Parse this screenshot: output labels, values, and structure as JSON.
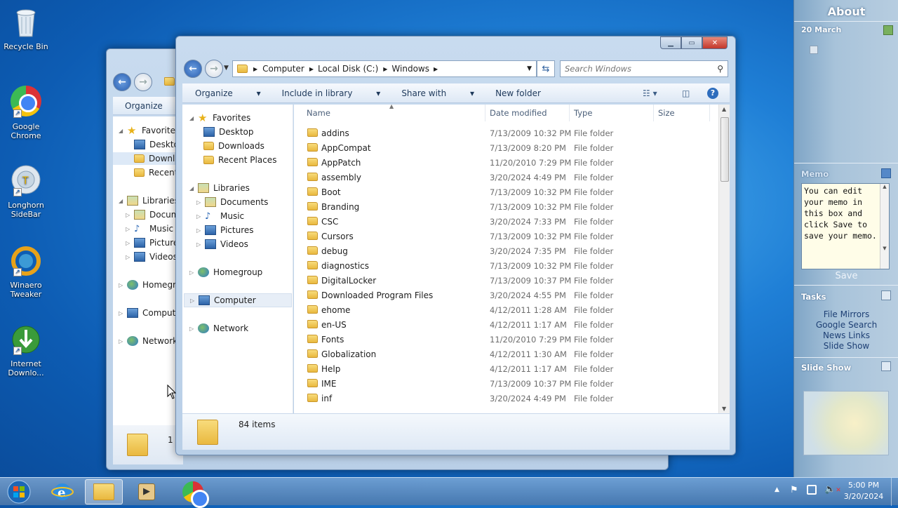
{
  "desktop": {
    "icons": [
      {
        "label": "Recycle Bin",
        "icon": "recycle-bin-icon"
      },
      {
        "label": "Google Chrome",
        "icon": "chrome-icon"
      },
      {
        "label": "Longhorn SideBar",
        "icon": "longhorn-sidebar-icon"
      },
      {
        "label": "Winaero Tweaker",
        "icon": "winaero-tweaker-icon"
      },
      {
        "label": "Internet Downlo...",
        "icon": "internet-download-manager-icon"
      }
    ]
  },
  "back_window": {
    "toolbar": {
      "organize": "Organize"
    },
    "nav": [
      {
        "label": "Favorites",
        "icon": "star-icon"
      },
      {
        "label": "Deskto",
        "icon": "desktop-icon"
      },
      {
        "label": "Downlo",
        "icon": "downloads-icon"
      },
      {
        "label": "Recent",
        "icon": "recent-icon"
      },
      {
        "label": "Libraries",
        "icon": "libraries-icon"
      },
      {
        "label": "Docume",
        "icon": "documents-icon"
      },
      {
        "label": "Music",
        "icon": "music-icon"
      },
      {
        "label": "Picture",
        "icon": "pictures-icon"
      },
      {
        "label": "Videos",
        "icon": "videos-icon"
      },
      {
        "label": "Homegro",
        "icon": "homegroup-icon"
      },
      {
        "label": "Compute",
        "icon": "computer-icon"
      },
      {
        "label": "Network",
        "icon": "network-icon"
      }
    ],
    "status": "1"
  },
  "explorer": {
    "breadcrumb": [
      "Computer",
      "Local Disk (C:)",
      "Windows"
    ],
    "search_placeholder": "Search Windows",
    "toolbar": {
      "organize": "Organize",
      "include": "Include in library",
      "share": "Share with",
      "new_folder": "New folder"
    },
    "nav": {
      "favorites": "Favorites",
      "desktop": "Desktop",
      "downloads": "Downloads",
      "recent": "Recent Places",
      "libraries": "Libraries",
      "documents": "Documents",
      "music": "Music",
      "pictures": "Pictures",
      "videos": "Videos",
      "homegroup": "Homegroup",
      "computer": "Computer",
      "network": "Network"
    },
    "columns": {
      "name": "Name",
      "date": "Date modified",
      "type": "Type",
      "size": "Size"
    },
    "files": [
      {
        "name": "addins",
        "date": "7/13/2009 10:32 PM",
        "type": "File folder"
      },
      {
        "name": "AppCompat",
        "date": "7/13/2009 8:20 PM",
        "type": "File folder"
      },
      {
        "name": "AppPatch",
        "date": "11/20/2010 7:29 PM",
        "type": "File folder"
      },
      {
        "name": "assembly",
        "date": "3/20/2024 4:49 PM",
        "type": "File folder"
      },
      {
        "name": "Boot",
        "date": "7/13/2009 10:32 PM",
        "type": "File folder"
      },
      {
        "name": "Branding",
        "date": "7/13/2009 10:32 PM",
        "type": "File folder"
      },
      {
        "name": "CSC",
        "date": "3/20/2024 7:33 PM",
        "type": "File folder"
      },
      {
        "name": "Cursors",
        "date": "7/13/2009 10:32 PM",
        "type": "File folder"
      },
      {
        "name": "debug",
        "date": "3/20/2024 7:35 PM",
        "type": "File folder"
      },
      {
        "name": "diagnostics",
        "date": "7/13/2009 10:32 PM",
        "type": "File folder"
      },
      {
        "name": "DigitalLocker",
        "date": "7/13/2009 10:37 PM",
        "type": "File folder"
      },
      {
        "name": "Downloaded Program Files",
        "date": "3/20/2024 4:55 PM",
        "type": "File folder"
      },
      {
        "name": "ehome",
        "date": "4/12/2011 1:28 AM",
        "type": "File folder"
      },
      {
        "name": "en-US",
        "date": "4/12/2011 1:17 AM",
        "type": "File folder"
      },
      {
        "name": "Fonts",
        "date": "11/20/2010 7:29 PM",
        "type": "File folder"
      },
      {
        "name": "Globalization",
        "date": "4/12/2011 1:30 AM",
        "type": "File folder"
      },
      {
        "name": "Help",
        "date": "4/12/2011 1:17 AM",
        "type": "File folder"
      },
      {
        "name": "IME",
        "date": "7/13/2009 10:37 PM",
        "type": "File folder"
      },
      {
        "name": "inf",
        "date": "3/20/2024 4:49 PM",
        "type": "File folder"
      }
    ],
    "status": "84 items"
  },
  "sidebar": {
    "title": "About",
    "date": "20 March",
    "memo_header": "Memo",
    "memo_text": "You can edit your memo in this box and click Save to save your memo.",
    "save": "Save",
    "tasks_header": "Tasks",
    "tasks": [
      "File Mirrors",
      "Google Search",
      "News Links",
      "Slide Show"
    ],
    "slideshow_header": "Slide Show"
  },
  "taskbar": {
    "time": "5:00 PM",
    "date": "3/20/2024",
    "buttons": [
      "start-orb-icon",
      "internet-explorer-icon",
      "windows-explorer-icon",
      "media-player-icon",
      "chrome-icon"
    ]
  }
}
